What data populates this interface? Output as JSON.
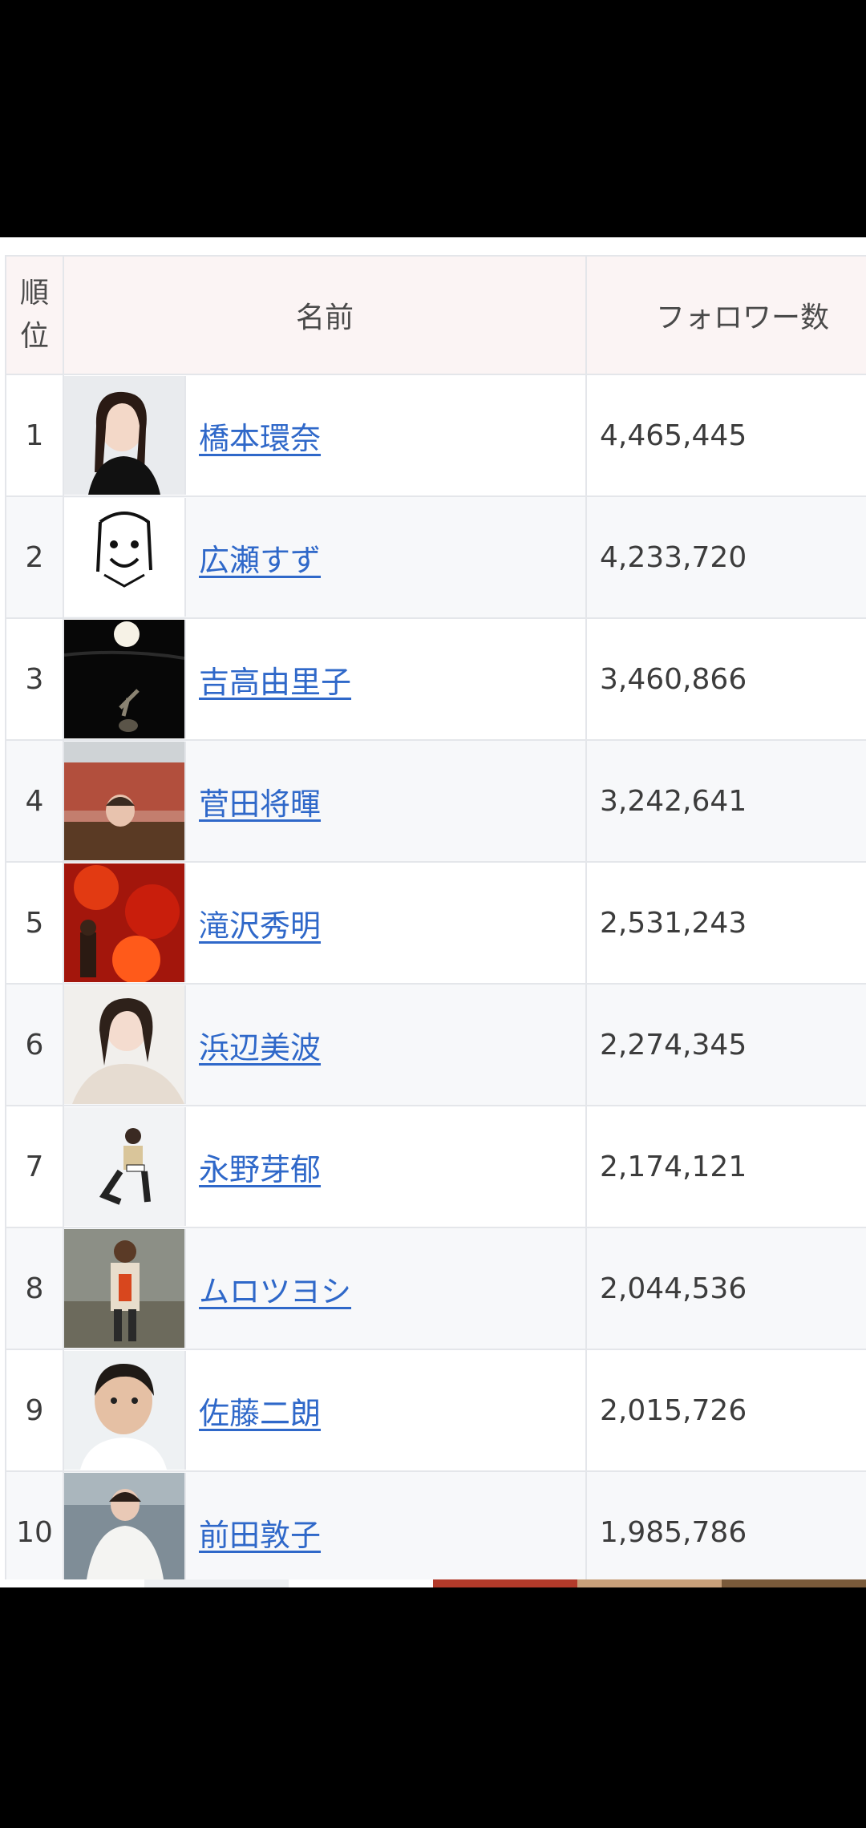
{
  "table": {
    "headers": {
      "rank": "順位",
      "name": "名前",
      "followers": "フォロワー数"
    },
    "rows": [
      {
        "rank": "1",
        "name": "橋本環奈",
        "followers": "4,465,445",
        "avatar_icon": "person-photo-icon"
      },
      {
        "rank": "2",
        "name": "広瀬すず",
        "followers": "4,233,720",
        "avatar_icon": "drawing-photo-icon"
      },
      {
        "rank": "3",
        "name": "吉高由里子",
        "followers": "3,460,866",
        "avatar_icon": "night-moon-photo-icon"
      },
      {
        "rank": "4",
        "name": "菅田将暉",
        "followers": "3,242,641",
        "avatar_icon": "person-photo-icon"
      },
      {
        "rank": "5",
        "name": "滝沢秀明",
        "followers": "2,531,243",
        "avatar_icon": "fire-photo-icon"
      },
      {
        "rank": "6",
        "name": "浜辺美波",
        "followers": "2,274,345",
        "avatar_icon": "person-photo-icon"
      },
      {
        "rank": "7",
        "name": "永野芽郁",
        "followers": "2,174,121",
        "avatar_icon": "person-photo-icon"
      },
      {
        "rank": "8",
        "name": "ムロツヨシ",
        "followers": "2,044,536",
        "avatar_icon": "person-photo-icon"
      },
      {
        "rank": "9",
        "name": "佐藤二朗",
        "followers": "2,015,726",
        "avatar_icon": "person-photo-icon"
      },
      {
        "rank": "10",
        "name": "前田敦子",
        "followers": "1,985,786",
        "avatar_icon": "person-photo-icon"
      }
    ]
  },
  "colors": {
    "header_bg": "#fbf4f4",
    "link": "#2f68c9",
    "row_alt": "#f7f8fa",
    "border": "#e4e6ea"
  }
}
